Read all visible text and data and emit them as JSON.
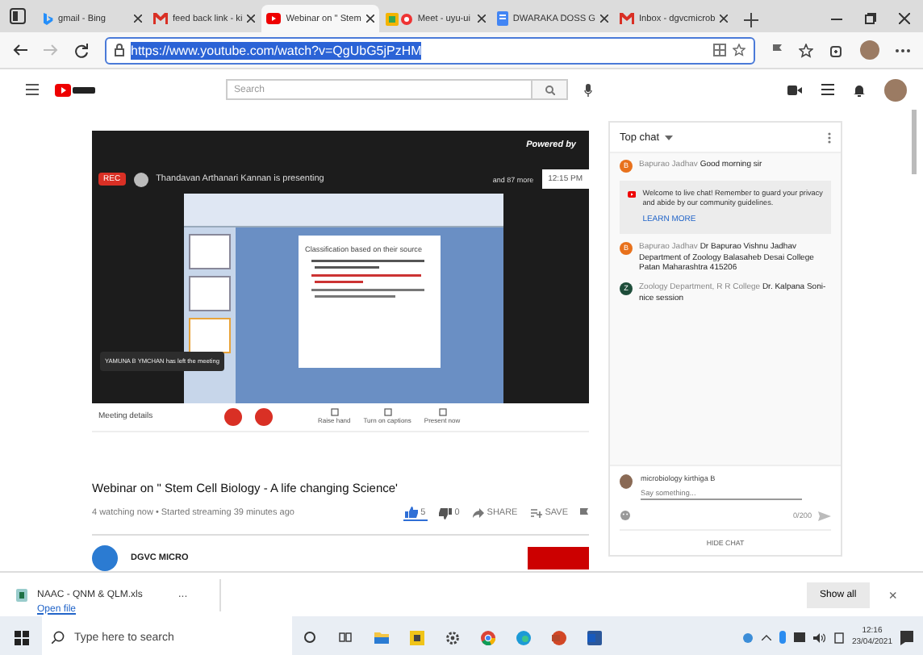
{
  "browser": {
    "tabs": [
      {
        "title": "gmail - Bing",
        "selected": false
      },
      {
        "title": "feed back link - ki",
        "selected": false
      },
      {
        "title": "Webinar on \" Stem",
        "selected": true
      },
      {
        "title": "Meet - uyu-ui",
        "selected": false
      },
      {
        "title": "DWARAKA DOSS G",
        "selected": false
      },
      {
        "title": "Inbox - dgvcmicrob",
        "selected": false
      }
    ],
    "address": {
      "value": "https://www.youtube.com/watch?v=QgUbG5jPzHM",
      "selected": true
    }
  },
  "youtube_header": {
    "search": {
      "placeholder": "Search"
    }
  },
  "video": {
    "rec_badge": "REC",
    "presenter": "Thandavan Arthanari Kannan is presenting",
    "participants": "and 87 more",
    "powered_by": "Powered by",
    "clock": "12:15 PM",
    "slide": {
      "heading": "Classification based on their source"
    },
    "toast": "YAMUNA B YMCHAN has left the meeting",
    "meeting_details": "Meeting details",
    "controls": [
      {
        "label": "Raise hand"
      },
      {
        "label": "Turn on captions"
      },
      {
        "label": "Present now"
      }
    ]
  },
  "video_info": {
    "title": "Webinar on \" Stem Cell Biology - A life changing Science'",
    "meta": "4 watching now • Started streaming 39 minutes ago",
    "like": {
      "count": "5",
      "selected": true
    },
    "dislike": {
      "count": "0",
      "selected": false
    },
    "share": "SHARE",
    "save": "SAVE",
    "channel": "DGVC MICRO"
  },
  "chat": {
    "title": "Top chat",
    "messages": [
      {
        "kind": "message",
        "initial": "B",
        "color": "#e8711c",
        "author": "Bapurao Jadhav",
        "text": "Good morning sir"
      },
      {
        "kind": "notice",
        "text": "Welcome to live chat! Remember to guard your privacy and abide by our community guidelines.",
        "link": "LEARN MORE"
      },
      {
        "kind": "message",
        "initial": "B",
        "color": "#e8711c",
        "author": "Bapurao Jadhav",
        "text": "Dr Bapurao Vishnu Jadhav Department of Zoology Balasaheb Desai College Patan Maharashtra 415206"
      },
      {
        "kind": "message",
        "initial": "Z",
        "color": "#1e4d3a",
        "author": "Zoology Department, R R College",
        "text": "Dr. Kalpana Soni- nice session"
      }
    ],
    "user": "microbiology kirthiga B",
    "placeholder": "Say something...",
    "counter": "0/200",
    "hide": "HIDE CHAT"
  },
  "download_bar": {
    "file": "NAAC - QNM & QLM.xls",
    "open": "Open file",
    "more": "...",
    "show_all": "Show all",
    "close": "×"
  },
  "taskbar": {
    "search_placeholder": "Type here to search",
    "time": "12:16",
    "date": "23/04/2021"
  }
}
